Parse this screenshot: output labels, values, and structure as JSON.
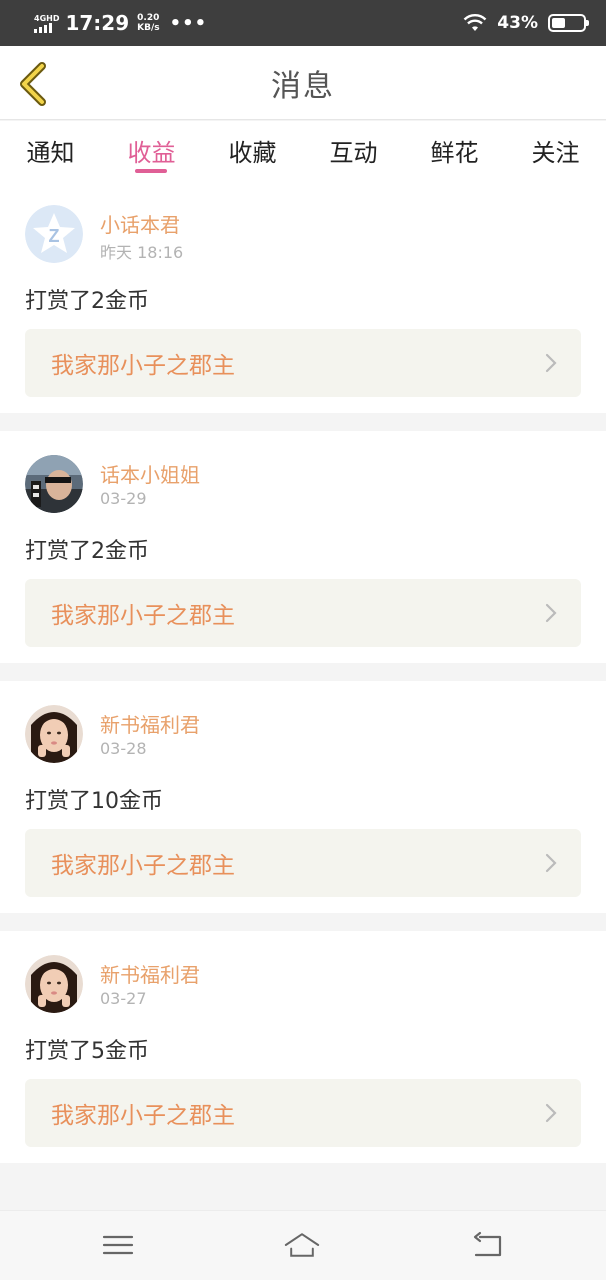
{
  "status_bar": {
    "network": "4GHD",
    "time": "17:29",
    "speed_value": "0.20",
    "speed_unit": "KB/s",
    "more": "•••",
    "battery_percent": "43%",
    "battery_level": 0.43
  },
  "header": {
    "title": "消息",
    "back_icon": "chevron-left-icon"
  },
  "tabs": [
    {
      "label": "通知",
      "active": false
    },
    {
      "label": "收益",
      "active": true
    },
    {
      "label": "收藏",
      "active": false
    },
    {
      "label": "互动",
      "active": false
    },
    {
      "label": "鲜花",
      "active": false
    },
    {
      "label": "关注",
      "active": false
    }
  ],
  "messages": [
    {
      "user": "小话本君",
      "date": "昨天 18:16",
      "action": "打赏了2金币",
      "book": "我家那小子之郡主",
      "avatar": "star-logo-avatar"
    },
    {
      "user": "话本小姐姐",
      "date": "03-29",
      "action": "打赏了2金币",
      "book": "我家那小子之郡主",
      "avatar": "photo-avatar"
    },
    {
      "user": "新书福利君",
      "date": "03-28",
      "action": "打赏了10金币",
      "book": "我家那小子之郡主",
      "avatar": "girl-photo-avatar"
    },
    {
      "user": "新书福利君",
      "date": "03-27",
      "action": "打赏了5金币",
      "book": "我家那小子之郡主",
      "avatar": "girl-photo-avatar"
    }
  ],
  "colors": {
    "accent": "#e05f96",
    "username": "#e8a16b",
    "book_title": "#e8905b",
    "book_bg": "#f4f4ee"
  },
  "navbar": {
    "icons": [
      "menu-icon",
      "home-icon",
      "back-icon"
    ]
  }
}
